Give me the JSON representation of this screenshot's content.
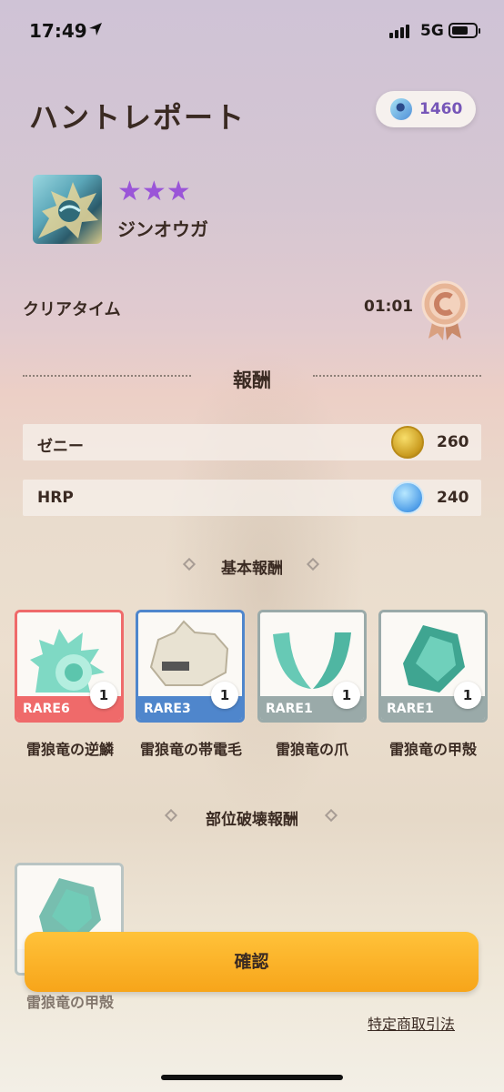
{
  "status_bar": {
    "time": "17:49",
    "network": "5G"
  },
  "header": {
    "title": "ハントレポート",
    "currency_amount": "1460"
  },
  "monster": {
    "name": "ジンオウガ",
    "stars": "★★★"
  },
  "clear": {
    "label": "クリアタイム",
    "time": "01:01"
  },
  "rewards": {
    "heading": "報酬",
    "zenny": {
      "label": "ゼニー",
      "value": "260"
    },
    "hrp": {
      "label": "HRP",
      "value": "240"
    }
  },
  "basic_rewards": {
    "heading": "基本報酬",
    "items": [
      {
        "name": "雷狼竜の逆鱗",
        "rarity": "RARE6",
        "count": "1",
        "color": "#ef6a6a"
      },
      {
        "name": "雷狼竜の帯電毛",
        "rarity": "RARE3",
        "count": "1",
        "color": "#4f86cc"
      },
      {
        "name": "雷狼竜の爪",
        "rarity": "RARE1",
        "count": "1",
        "color": "#9aaaa9"
      },
      {
        "name": "雷狼竜の甲殻",
        "rarity": "RARE1",
        "count": "1",
        "color": "#9aaaa9"
      }
    ]
  },
  "part_break_rewards": {
    "heading": "部位破壊報酬",
    "items": [
      {
        "name": "雷狼竜の甲殻"
      }
    ]
  },
  "actions": {
    "confirm": "確認",
    "legal_link": "特定商取引法"
  },
  "icons": {
    "location": "location-arrow-icon",
    "currency": "paw-gem-icon",
    "medal": "rank-c-medal-icon",
    "zenny": "zenny-coin-icon",
    "hrp": "hrp-orb-icon"
  }
}
